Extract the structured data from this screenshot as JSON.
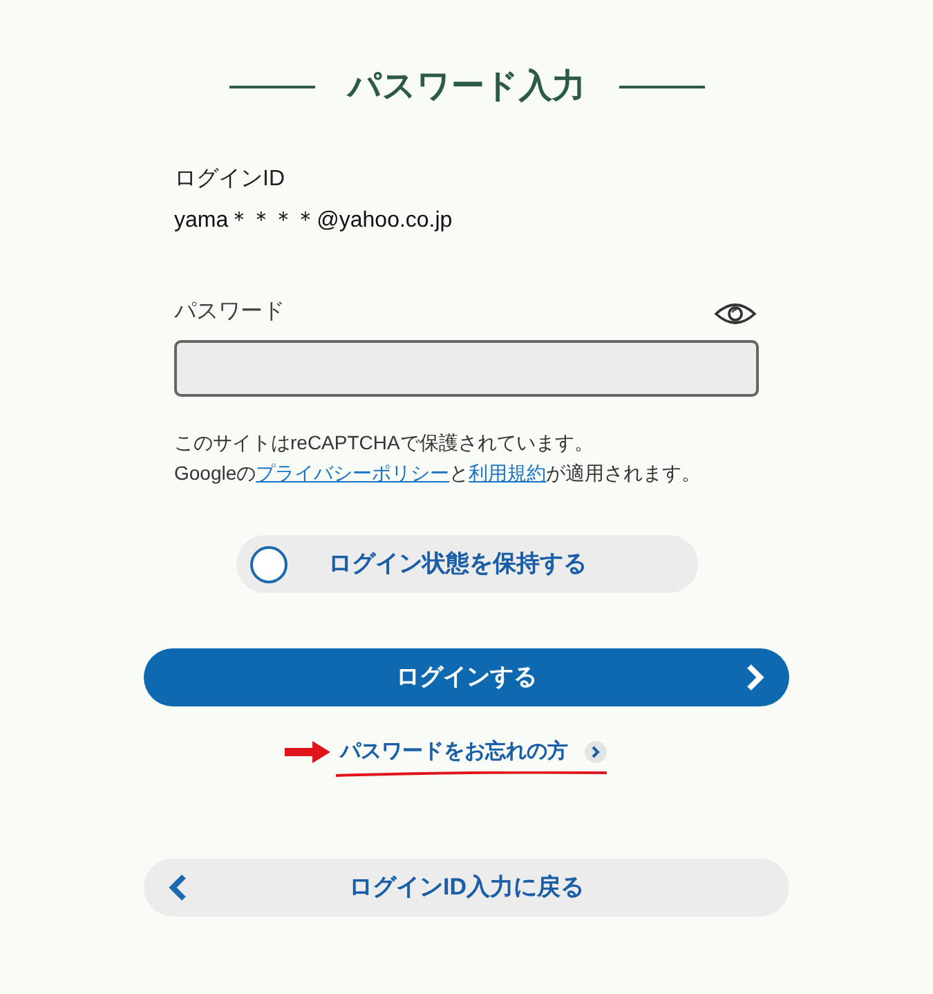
{
  "title": "パスワード入力",
  "login_id": {
    "label": "ログインID",
    "value": "yama＊＊＊＊@yahoo.co.jp"
  },
  "password": {
    "label": "パスワード"
  },
  "notice": {
    "line1": "このサイトはreCAPTCHAで保護されています。",
    "prefix": "Googleの",
    "privacy_link": "プライバシーポリシー",
    "and": "と",
    "terms_link": "利用規約",
    "suffix": "が適用されます。"
  },
  "keep_login": {
    "label": "ログイン状態を保持する",
    "checked": false
  },
  "login_button": "ログインする",
  "forgot_link": "パスワードをお忘れの方",
  "back_button": "ログインID入力に戻る"
}
